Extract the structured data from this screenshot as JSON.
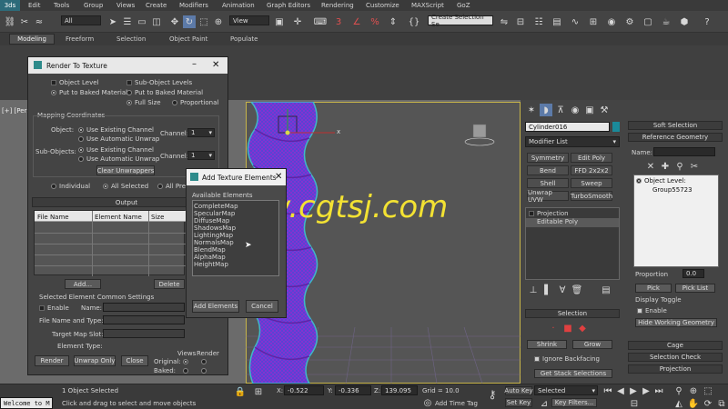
{
  "menu": [
    "Edit",
    "Tools",
    "Group",
    "Views",
    "Create",
    "Modifiers",
    "Animation",
    "Graph Editors",
    "Rendering",
    "Customize",
    "MAXScript",
    "GoZ"
  ],
  "toolbar": {
    "filter_select": "All",
    "view_select": "View",
    "named_selection": "Create Selection Se"
  },
  "ribbon_tabs": [
    "Modeling",
    "Freeform",
    "Selection",
    "Object Paint",
    "Populate"
  ],
  "viewport": {
    "label": "[+] [Persp",
    "axis_x": "x"
  },
  "watermark": "www.cgtsj.com",
  "render_to_texture": {
    "title": "Render To Texture",
    "object_level": "Object Level",
    "sub_object_levels": "Sub-Object Levels",
    "put_to_baked": "Put to Baked Material",
    "put_to_baked_2": "Put to Baked Material",
    "full_size": "Full Size",
    "proportional": "Proportional",
    "mapping_coords": "Mapping Coordinates",
    "object_label": "Object:",
    "use_existing": "Use Existing Channel",
    "use_auto": "Use Automatic Unwrap",
    "channel_label": "Channel:",
    "channel_val": "1",
    "sub_objects_label": "Sub-Objects:",
    "use_existing_2": "Use Existing Channel",
    "use_auto_2": "Use Automatic Unwrap",
    "channel_label_2": "Channel:",
    "channel_val_2": "1",
    "clear_unwrappers": "Clear Unwrappers",
    "individual": "Individual",
    "all_selected": "All Selected",
    "all_prepared": "All Prepa",
    "output": "Output",
    "col_file_name": "File Name",
    "col_element_name": "Element Name",
    "col_size": "Size",
    "add_btn": "Add...",
    "delete_btn": "Delete",
    "sel_common": "Selected Element Common Settings",
    "enable": "Enable",
    "name_label": "Name:",
    "file_name_type": "File Name and Type:",
    "target_map_slot": "Target Map Slot:",
    "element_type": "Element Type:",
    "render_btn": "Render",
    "unwrap_only": "Unwrap Only",
    "close_btn": "Close",
    "views_label": "Views",
    "render_label": "Render",
    "original_label": "Original:",
    "baked_label": "Baked:"
  },
  "add_texture": {
    "title": "Add Texture Elements",
    "available": "Available Elements",
    "items": [
      "CompleteMap",
      "SpecularMap",
      "DiffuseMap",
      "ShadowsMap",
      "LightingMap",
      "NormalsMap",
      "BlendMap",
      "AlphaMap",
      "HeightMap"
    ],
    "add_elements": "Add Elements",
    "cancel": "Cancel"
  },
  "command_panel": {
    "object_name": "Cylinder016",
    "modifier_list": "Modifier List",
    "buttons": [
      "Symmetry",
      "Edit Poly",
      "Bend",
      "FFD 2x2x2",
      "Shell",
      "Sweep",
      "Unwrap UVW",
      "TurboSmooth"
    ],
    "stack": [
      "Projection",
      "Editable Poly"
    ],
    "selection_rollout": "Selection",
    "shrink": "Shrink",
    "grow": "Grow",
    "ignore_backfacing": "Ignore Backfacing",
    "get_stack": "Get Stack Selections"
  },
  "projection_panel": {
    "soft_selection": "Soft Selection",
    "reference_geometry": "Reference Geometry",
    "name_label": "Name:",
    "object_level": "Object Level:",
    "group": "Group55723",
    "proportion": "Proportion",
    "proportion_val": "0.0",
    "pick": "Pick",
    "pick_list": "Pick List",
    "display_toggle": "Display Toggle",
    "enable": "Enable",
    "hide_working": "Hide Working Geometry",
    "cage": "Cage",
    "selection_check": "Selection Check",
    "projection": "Projection"
  },
  "status": {
    "selected": "1 Object Selected",
    "prompt": "Click and drag to select and move objects",
    "welcome": "Welcome to M",
    "x_val": "-0.522",
    "y_val": "-0.336",
    "z_val": "139.095",
    "grid": "Grid = 10.0",
    "auto_key": "Auto Key",
    "set_key": "Set Key",
    "selected_dd": "Selected",
    "key_filters": "Key Filters...",
    "add_time_tag": "Add Time Tag",
    "x_label": "X:",
    "y_label": "Y:",
    "z_label": "Z:"
  }
}
